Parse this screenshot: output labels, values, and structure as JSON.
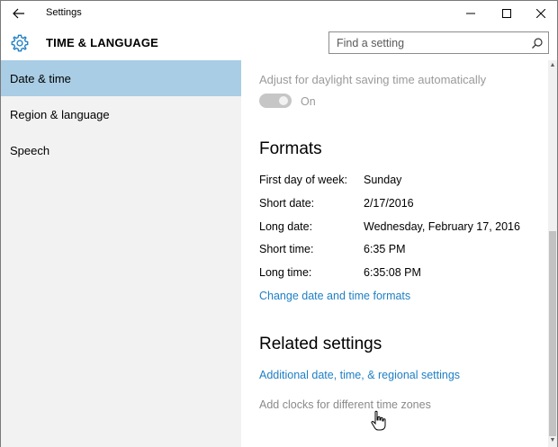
{
  "window": {
    "title": "Settings"
  },
  "header": {
    "section_title": "TIME & LANGUAGE",
    "search_placeholder": "Find a setting"
  },
  "sidebar": {
    "items": [
      {
        "label": "Date & time",
        "selected": true
      },
      {
        "label": "Region & language",
        "selected": false
      },
      {
        "label": "Speech",
        "selected": false
      }
    ]
  },
  "main": {
    "dst": {
      "label": "Adjust for daylight saving time automatically",
      "state": "On",
      "enabled": false
    },
    "formats": {
      "heading": "Formats",
      "rows": [
        {
          "label": "First day of week:",
          "value": "Sunday"
        },
        {
          "label": "Short date:",
          "value": "2/17/2016"
        },
        {
          "label": "Long date:",
          "value": "Wednesday, February 17, 2016"
        },
        {
          "label": "Short time:",
          "value": "6:35 PM"
        },
        {
          "label": "Long time:",
          "value": "6:35:08 PM"
        }
      ],
      "change_link": "Change date and time formats"
    },
    "related": {
      "heading": "Related settings",
      "regional_link": "Additional date, time, & regional settings",
      "clocks_link": "Add clocks for different time zones"
    }
  },
  "colors": {
    "selection": "#a9cde4",
    "link": "#1e7fc4",
    "sidebar_bg": "#f2f2f2",
    "accent_icon": "#1e7fc4"
  },
  "icons": [
    "back-arrow-icon",
    "minimize-icon",
    "maximize-icon",
    "close-icon",
    "gear-icon",
    "search-icon",
    "hand-cursor-icon"
  ]
}
